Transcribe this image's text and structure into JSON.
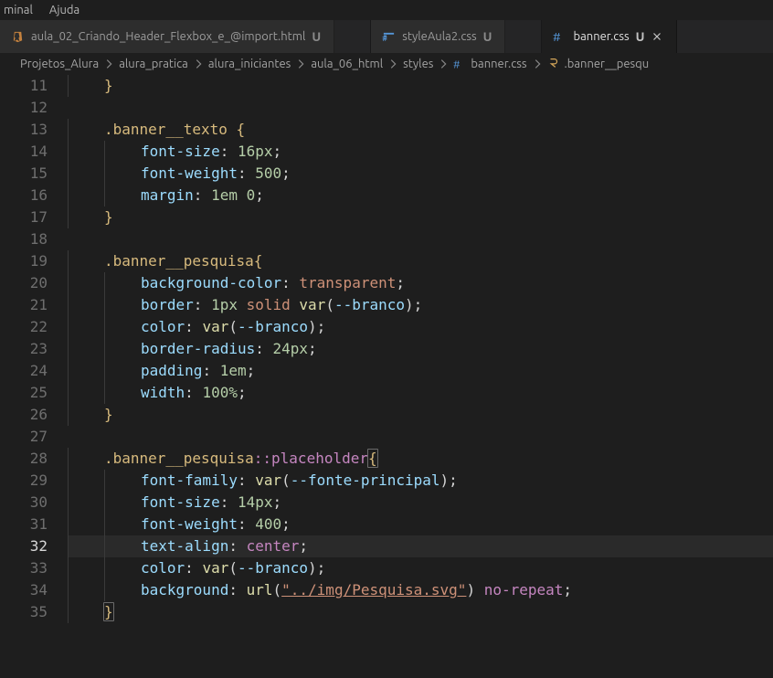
{
  "menubar": {
    "items": [
      "minal",
      "Ajuda"
    ]
  },
  "tabs": [
    {
      "icon": "html",
      "label": "aula_02_Criando_Header_Flexbox_e_@import.html",
      "modified": "U",
      "active": false,
      "closeable": false
    },
    {
      "icon": "css",
      "label": "styleAula2.css",
      "modified": "U",
      "active": false,
      "closeable": false
    },
    {
      "icon": "css",
      "label": "banner.css",
      "modified": "U",
      "active": true,
      "closeable": true
    }
  ],
  "breadcrumb": {
    "segments": [
      "Projetos_Alura",
      "alura_pratica",
      "alura_iniciantes",
      "aula_06_html",
      "styles"
    ],
    "file": {
      "icon": "css",
      "name": "banner.css"
    },
    "symbol": {
      "icon": "rule",
      "name": ".banner__pesqu"
    }
  },
  "editor": {
    "current_line": 32,
    "first_line": 11,
    "lines": [
      {
        "n": 11,
        "tokens": [
          {
            "t": "indent",
            "w": 1
          },
          {
            "t": "punc",
            "v": "}"
          }
        ]
      },
      {
        "n": 12,
        "tokens": []
      },
      {
        "n": 13,
        "tokens": [
          {
            "t": "indent",
            "w": 1
          },
          {
            "t": "sel",
            "v": ".banner__texto"
          },
          {
            "t": "white",
            "v": " "
          },
          {
            "t": "punc",
            "v": "{"
          }
        ]
      },
      {
        "n": 14,
        "tokens": [
          {
            "t": "indent",
            "w": 2
          },
          {
            "t": "prop",
            "v": "font-size"
          },
          {
            "t": "white",
            "v": ": "
          },
          {
            "t": "num",
            "v": "16px"
          },
          {
            "t": "white",
            "v": ";"
          }
        ]
      },
      {
        "n": 15,
        "tokens": [
          {
            "t": "indent",
            "w": 2
          },
          {
            "t": "prop",
            "v": "font-weight"
          },
          {
            "t": "white",
            "v": ": "
          },
          {
            "t": "num",
            "v": "500"
          },
          {
            "t": "white",
            "v": ";"
          }
        ]
      },
      {
        "n": 16,
        "tokens": [
          {
            "t": "indent",
            "w": 2
          },
          {
            "t": "prop",
            "v": "margin"
          },
          {
            "t": "white",
            "v": ": "
          },
          {
            "t": "num",
            "v": "1em"
          },
          {
            "t": "white",
            "v": " "
          },
          {
            "t": "num",
            "v": "0"
          },
          {
            "t": "white",
            "v": ";"
          }
        ]
      },
      {
        "n": 17,
        "tokens": [
          {
            "t": "indent",
            "w": 1
          },
          {
            "t": "punc",
            "v": "}"
          }
        ]
      },
      {
        "n": 18,
        "tokens": []
      },
      {
        "n": 19,
        "tokens": [
          {
            "t": "indent",
            "w": 1
          },
          {
            "t": "sel",
            "v": ".banner__pesquisa"
          },
          {
            "t": "punc",
            "v": "{"
          }
        ]
      },
      {
        "n": 20,
        "tokens": [
          {
            "t": "indent",
            "w": 2
          },
          {
            "t": "prop",
            "v": "background-color"
          },
          {
            "t": "white",
            "v": ": "
          },
          {
            "t": "const",
            "v": "transparent"
          },
          {
            "t": "white",
            "v": ";"
          }
        ]
      },
      {
        "n": 21,
        "tokens": [
          {
            "t": "indent",
            "w": 2
          },
          {
            "t": "prop",
            "v": "border"
          },
          {
            "t": "white",
            "v": ": "
          },
          {
            "t": "num",
            "v": "1px"
          },
          {
            "t": "white",
            "v": " "
          },
          {
            "t": "const",
            "v": "solid"
          },
          {
            "t": "white",
            "v": " "
          },
          {
            "t": "func",
            "v": "var"
          },
          {
            "t": "white",
            "v": "("
          },
          {
            "t": "varid",
            "v": "--branco"
          },
          {
            "t": "white",
            "v": ");"
          }
        ]
      },
      {
        "n": 22,
        "tokens": [
          {
            "t": "indent",
            "w": 2
          },
          {
            "t": "prop",
            "v": "color"
          },
          {
            "t": "white",
            "v": ": "
          },
          {
            "t": "func",
            "v": "var"
          },
          {
            "t": "white",
            "v": "("
          },
          {
            "t": "varid",
            "v": "--branco"
          },
          {
            "t": "white",
            "v": ");"
          }
        ]
      },
      {
        "n": 23,
        "tokens": [
          {
            "t": "indent",
            "w": 2
          },
          {
            "t": "prop",
            "v": "border-radius"
          },
          {
            "t": "white",
            "v": ": "
          },
          {
            "t": "num",
            "v": "24px"
          },
          {
            "t": "white",
            "v": ";"
          }
        ]
      },
      {
        "n": 24,
        "tokens": [
          {
            "t": "indent",
            "w": 2
          },
          {
            "t": "prop",
            "v": "padding"
          },
          {
            "t": "white",
            "v": ": "
          },
          {
            "t": "num",
            "v": "1em"
          },
          {
            "t": "white",
            "v": ";"
          }
        ]
      },
      {
        "n": 25,
        "tokens": [
          {
            "t": "indent",
            "w": 2
          },
          {
            "t": "prop",
            "v": "width"
          },
          {
            "t": "white",
            "v": ": "
          },
          {
            "t": "num",
            "v": "100%"
          },
          {
            "t": "white",
            "v": ";"
          }
        ]
      },
      {
        "n": 26,
        "tokens": [
          {
            "t": "indent",
            "w": 1
          },
          {
            "t": "punc",
            "v": "}"
          }
        ]
      },
      {
        "n": 27,
        "tokens": []
      },
      {
        "n": 28,
        "tokens": [
          {
            "t": "indent",
            "w": 1
          },
          {
            "t": "sel",
            "v": ".banner__pesquisa"
          },
          {
            "t": "kw",
            "v": "::placeholder"
          },
          {
            "t": "punc_m",
            "v": "{"
          }
        ]
      },
      {
        "n": 29,
        "tokens": [
          {
            "t": "indent",
            "w": 2
          },
          {
            "t": "prop",
            "v": "font-family"
          },
          {
            "t": "white",
            "v": ": "
          },
          {
            "t": "func",
            "v": "var"
          },
          {
            "t": "white",
            "v": "("
          },
          {
            "t": "varid",
            "v": "--fonte-principal"
          },
          {
            "t": "white",
            "v": ");"
          }
        ]
      },
      {
        "n": 30,
        "tokens": [
          {
            "t": "indent",
            "w": 2
          },
          {
            "t": "prop",
            "v": "font-size"
          },
          {
            "t": "white",
            "v": ": "
          },
          {
            "t": "num",
            "v": "14px"
          },
          {
            "t": "white",
            "v": ";"
          }
        ]
      },
      {
        "n": 31,
        "tokens": [
          {
            "t": "indent",
            "w": 2
          },
          {
            "t": "prop",
            "v": "font-weight"
          },
          {
            "t": "white",
            "v": ": "
          },
          {
            "t": "num",
            "v": "400"
          },
          {
            "t": "white",
            "v": ";"
          }
        ]
      },
      {
        "n": 32,
        "tokens": [
          {
            "t": "indent",
            "w": 2
          },
          {
            "t": "prop",
            "v": "text-align"
          },
          {
            "t": "white",
            "v": ": "
          },
          {
            "t": "kw",
            "v": "center"
          },
          {
            "t": "white",
            "v": ";"
          }
        ]
      },
      {
        "n": 33,
        "tokens": [
          {
            "t": "indent",
            "w": 2
          },
          {
            "t": "prop",
            "v": "color"
          },
          {
            "t": "white",
            "v": ": "
          },
          {
            "t": "func",
            "v": "var"
          },
          {
            "t": "white",
            "v": "("
          },
          {
            "t": "varid",
            "v": "--branco"
          },
          {
            "t": "white",
            "v": ");"
          }
        ]
      },
      {
        "n": 34,
        "tokens": [
          {
            "t": "indent",
            "w": 2
          },
          {
            "t": "prop",
            "v": "background"
          },
          {
            "t": "white",
            "v": ": "
          },
          {
            "t": "func",
            "v": "url"
          },
          {
            "t": "white",
            "v": "("
          },
          {
            "t": "strg",
            "v": "\"../img/Pesquisa.svg\""
          },
          {
            "t": "white",
            "v": ") "
          },
          {
            "t": "kw",
            "v": "no-repeat"
          },
          {
            "t": "white",
            "v": ";"
          }
        ]
      },
      {
        "n": 35,
        "tokens": [
          {
            "t": "indent",
            "w": 1
          },
          {
            "t": "punc_m",
            "v": "}"
          }
        ]
      }
    ]
  }
}
